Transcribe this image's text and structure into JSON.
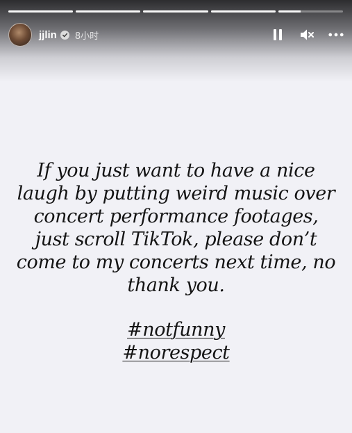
{
  "progress": {
    "segments": [
      1,
      1,
      1,
      1,
      0.35
    ]
  },
  "header": {
    "username": "jjlin",
    "time_ago": "8小时"
  },
  "icons": {
    "pause": "pause-icon",
    "mute": "mute-icon",
    "more": "more-icon",
    "verified": "verified-badge-icon"
  },
  "story": {
    "text": "If you just want to have a nice laugh by putting weird music over concert performance footages, just scroll TikTok, please don’t come to my concerts next time, no thank you.",
    "hashtags": [
      "#notfunny",
      "#norespect"
    ]
  },
  "colors": {
    "background": "#f1f1f6",
    "text": "#141414"
  }
}
